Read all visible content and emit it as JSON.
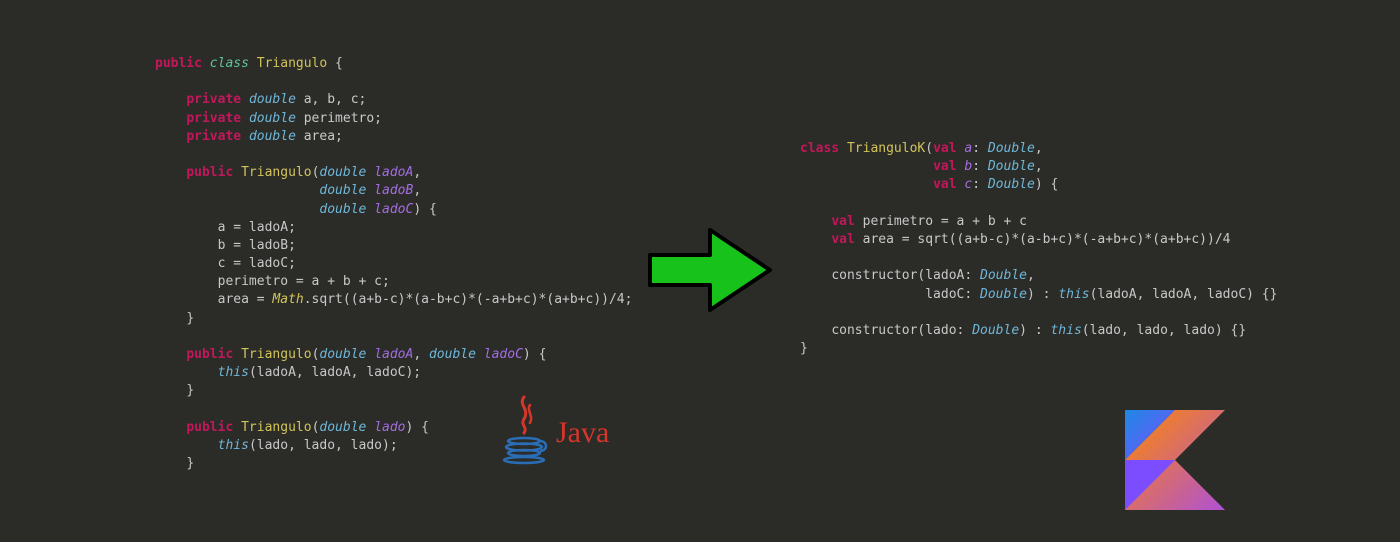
{
  "java": {
    "l1": "public",
    "l1b": "class",
    "l1c": "Triangulo",
    "l1d": " {",
    "l2": "private",
    "l2t": "double",
    "l2v": " a, b, c;",
    "l3": "private",
    "l3t": "double",
    "l3v": " perimetro;",
    "l4": "private",
    "l4t": "double",
    "l4v": " area;",
    "l5": "public",
    "l5c": "Triangulo",
    "l5p1t": "double",
    "l5p1n": "ladoA",
    "l5c1": ",",
    "l6p2t": "double",
    "l6p2n": "ladoB",
    "l6c2": ",",
    "l7p3t": "double",
    "l7p3n": "ladoC",
    "l7e": ") {",
    "l8": "a = ladoA;",
    "l9": "b = ladoB;",
    "l10": "c = ladoC;",
    "l11": "perimetro = a + b + c;",
    "l12a": "area = ",
    "l12b": "Math",
    "l12c": ".sqrt((a+b-c)*(a-b+c)*(-a+b+c)*(a+b+c))/4;",
    "l13": "}",
    "l14k": "public",
    "l14c": "Triangulo",
    "l14p1t": "double",
    "l14p1n": "ladoA",
    "l14comma": ", ",
    "l14p2t": "double",
    "l14p2n": "ladoC",
    "l14e": ") {",
    "l15a": "this",
    "l15b": "(ladoA, ladoA, ladoC);",
    "l16": "}",
    "l17k": "public",
    "l17c": "Triangulo",
    "l17pt": "double",
    "l17pn": "lado",
    "l17e": ") {",
    "l18a": "this",
    "l18b": "(lado, lado, lado);",
    "l19": "}"
  },
  "kotlin": {
    "k1a": "class",
    "k1b": "TrianguloK",
    "k1c": "(",
    "k1d": "val",
    "k1e": "a",
    "k1f": ": ",
    "k1g": "Double",
    "k1h": ",",
    "k2d": "val",
    "k2e": "b",
    "k2g": "Double",
    "k2h": ",",
    "k3d": "val",
    "k3e": "c",
    "k3g": "Double",
    "k3h": ") {",
    "k4a": "val",
    "k4b": " perimetro = a + b + c",
    "k5a": "val",
    "k5b": " area = sqrt((a+b-c)*(a-b+c)*(-a+b+c)*(a+b+c))/4",
    "k6a": "constructor(ladoA: ",
    "k6b": "Double",
    "k6c": ",",
    "k7a": "ladoC: ",
    "k7b": "Double",
    "k7c": ") : ",
    "k7d": "this",
    "k7e": "(ladoA, ladoA, ladoC) {}",
    "k8a": "constructor(lado: ",
    "k8b": "Double",
    "k8c": ") : ",
    "k8d": "this",
    "k8e": "(lado, lado, lado) {}",
    "k9": "}"
  },
  "javaLogoText": "Java"
}
